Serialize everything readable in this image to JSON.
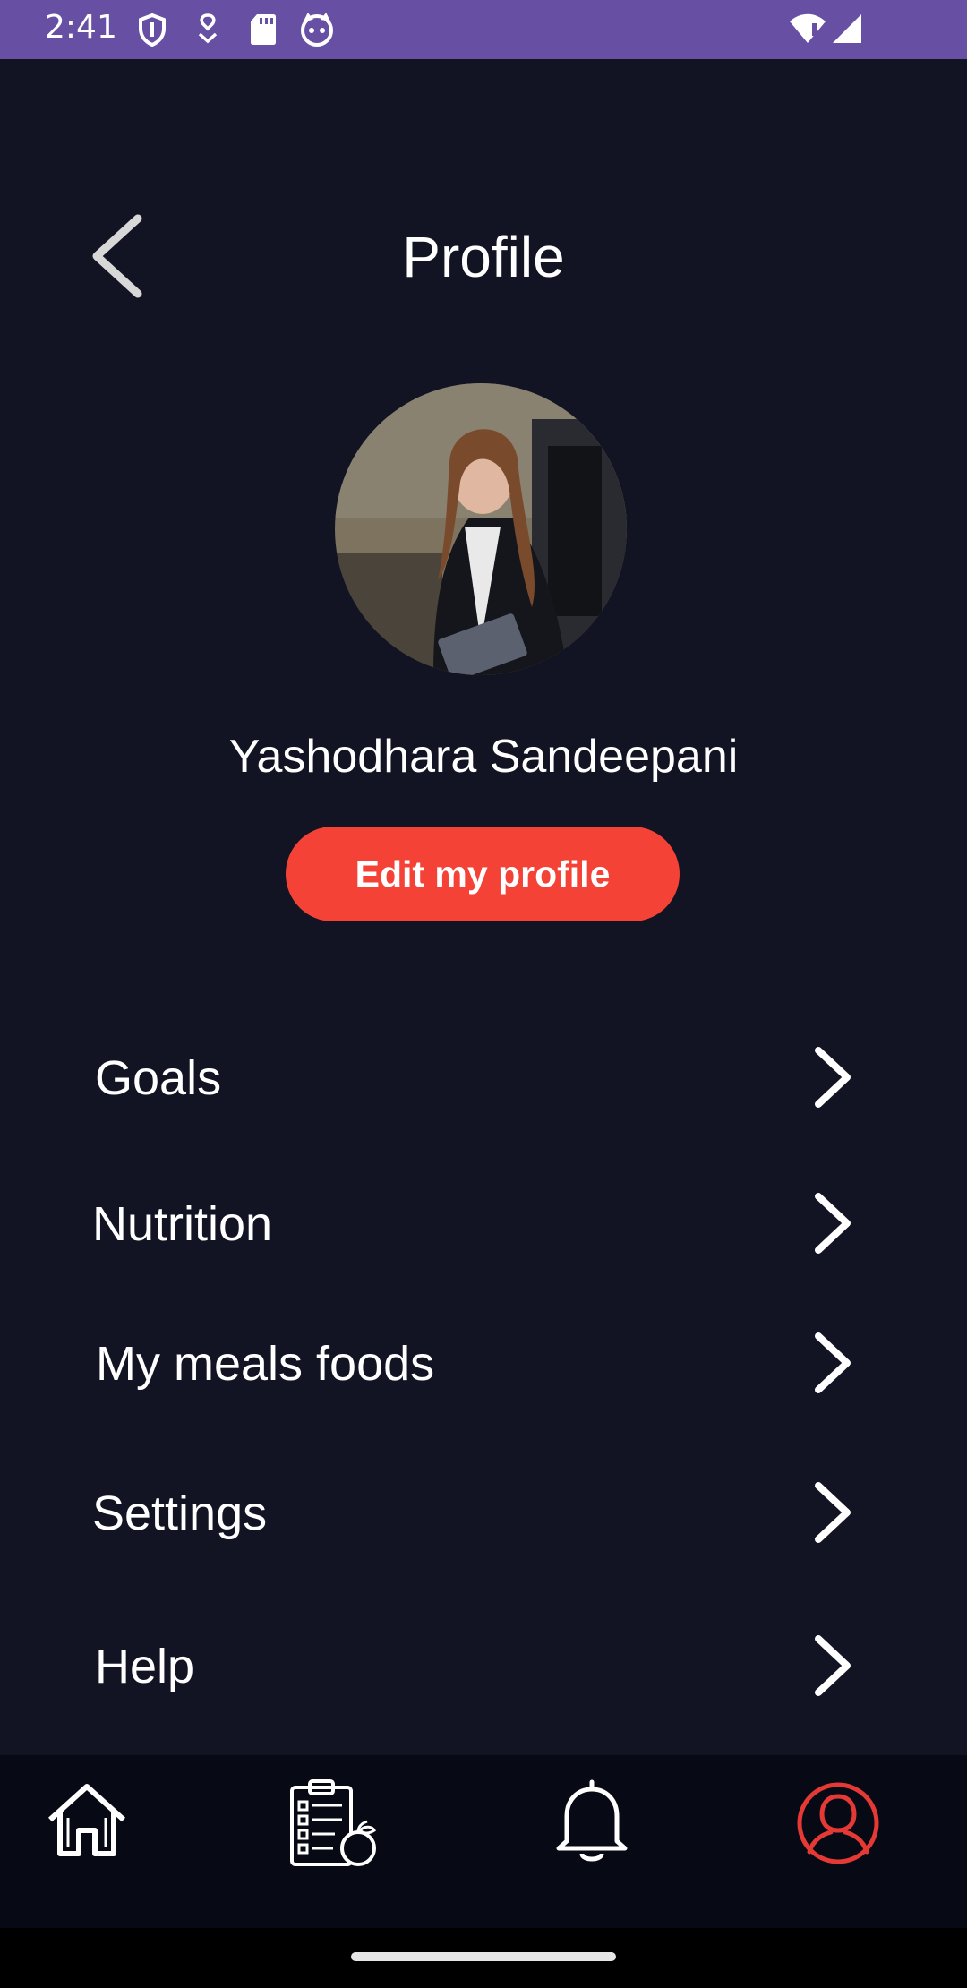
{
  "status_bar": {
    "time": "2:41",
    "icons": [
      "shield-icon",
      "location-drop-icon",
      "sd-card-icon",
      "cat-face-icon",
      "wifi-alert-icon",
      "cell-signal-icon"
    ],
    "color": "#6750A4"
  },
  "header": {
    "title": "Profile",
    "back_icon": "chevron-left-icon"
  },
  "profile": {
    "name": "Yashodhara Sandeepani",
    "avatar_description": "profile photo",
    "edit_label": "Edit my profile",
    "edit_color": "#F44336"
  },
  "menu": {
    "items": [
      {
        "label": "Goals"
      },
      {
        "label": "Nutrition"
      },
      {
        "label": "My meals foods"
      },
      {
        "label": "Settings"
      },
      {
        "label": "Help"
      }
    ],
    "chevron_icon": "chevron-right-icon"
  },
  "bottom_nav": {
    "items": [
      {
        "icon": "home-icon",
        "active": false
      },
      {
        "icon": "meal-plan-icon",
        "active": false
      },
      {
        "icon": "bell-icon",
        "active": false
      },
      {
        "icon": "profile-icon",
        "active": true
      }
    ],
    "active_color": "#E53935"
  },
  "colors": {
    "background": "#121424",
    "nav_background": "#070914"
  }
}
